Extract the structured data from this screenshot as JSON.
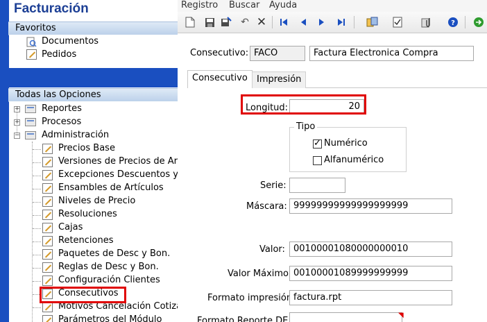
{
  "app": {
    "title": "Facturación"
  },
  "sections": {
    "favoritos": "Favoritos",
    "todas": "Todas las Opciones"
  },
  "favorites": [
    "Documentos",
    "Pedidos"
  ],
  "tree": {
    "top": [
      "Reportes",
      "Procesos",
      "Administración"
    ],
    "children": [
      "Precios Base",
      "Versiones de Precios de Artí",
      "Excepciones Descuentos y B",
      "Ensambles de Artículos",
      "Niveles de Precio",
      "Resoluciones",
      "Cajas",
      "Retenciones",
      "Paquetes de Desc y Bon.",
      "Reglas de Desc y Bon.",
      "Configuración Clientes",
      "Consecutivos",
      "Motivos Cancelación Cotizac",
      "Parámetros del Módulo"
    ]
  },
  "menu": {
    "registro": "Registro",
    "buscar": "Buscar",
    "ayuda": "Ayuda"
  },
  "toolbar": {
    "icons": [
      "new-icon",
      "save-icon",
      "save-as-icon",
      "undo-icon",
      "delete-icon",
      "first-icon",
      "previous-icon",
      "next-icon",
      "last-icon",
      "copy-icon",
      "check-icon",
      "attach-icon",
      "help-icon",
      "go-icon"
    ]
  },
  "form": {
    "consecutivo_label": "Consecutivo:",
    "consecutivo_code": "FACO",
    "consecutivo_desc": "Factura Electronica Compra",
    "tabs": [
      "Consecutivo",
      "Impresión"
    ],
    "longitud_label": "Longitud:",
    "longitud_value": "20",
    "tipo_label": "Tipo",
    "numerico_label": "Numérico",
    "numerico_checked": true,
    "alfanumerico_label": "Alfanumérico",
    "alfanumerico_checked": false,
    "serie_label": "Serie:",
    "serie_value": "",
    "mascara_label": "Máscara:",
    "mascara_value": "99999999999999999999",
    "valor_label": "Valor:",
    "valor_value": "00100001080000000010",
    "valor_max_label": "Valor Máximo:",
    "valor_max_value": "00100001089999999999",
    "formato_imp_label": "Formato impresión:",
    "formato_imp_value": "factura.rpt",
    "formato_rep_label": "Formato Reporte DE:",
    "formato_rep_value": ""
  },
  "colors": {
    "accent_blue": "#1a4fc0",
    "highlight_red": "#e00000",
    "title_blue": "#1c3f95"
  }
}
